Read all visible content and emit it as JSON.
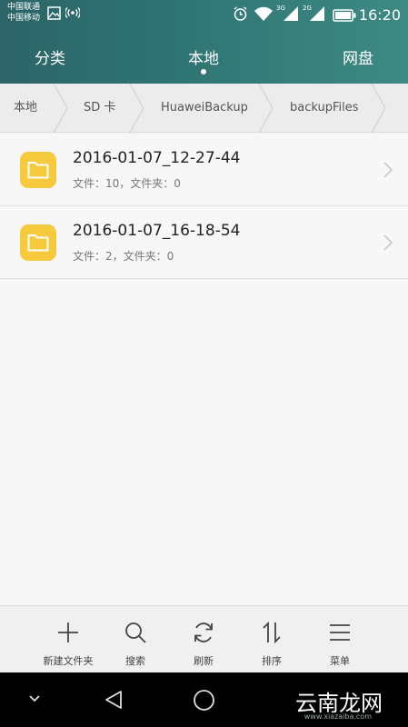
{
  "status_bar": {
    "carrier_1": "中国联通",
    "carrier_2": "中国移动",
    "network_1": "3G",
    "network_2": "2G",
    "time": "16:20",
    "icons": [
      "image-icon",
      "hotspot-icon",
      "alarm-icon",
      "wifi-icon",
      "signal-icon",
      "signal-icon",
      "battery-icon"
    ]
  },
  "tabs": {
    "items": [
      {
        "label": "分类"
      },
      {
        "label": "本地"
      },
      {
        "label": "网盘"
      }
    ],
    "active": "本地"
  },
  "breadcrumb": {
    "items": [
      {
        "label": "本地"
      },
      {
        "label": "SD 卡"
      },
      {
        "label": "HuaweiBackup"
      },
      {
        "label": "backupFiles"
      }
    ]
  },
  "files": {
    "items": [
      {
        "name": "2016-01-07_12-27-44",
        "meta": "文件：10，文件夹：0",
        "icon": "folder-icon"
      },
      {
        "name": "2016-01-07_16-18-54",
        "meta": "文件：2，文件夹：0",
        "icon": "folder-icon"
      }
    ]
  },
  "toolbar": {
    "items": [
      {
        "label": "新建文件夹",
        "icon": "plus-icon"
      },
      {
        "label": "搜索",
        "icon": "search-icon"
      },
      {
        "label": "刷新",
        "icon": "refresh-icon"
      },
      {
        "label": "排序",
        "icon": "sort-icon"
      },
      {
        "label": "菜单",
        "icon": "menu-icon"
      }
    ]
  },
  "navbar": {
    "icons": [
      "collapse-icon",
      "back-icon",
      "home-icon"
    ],
    "watermark": "云南龙网",
    "watermark_sub": "www.xiazaiba.com"
  },
  "colors": {
    "header_start": "#2c6467",
    "header_end": "#3e8a84",
    "folder": "#f7c93c"
  }
}
